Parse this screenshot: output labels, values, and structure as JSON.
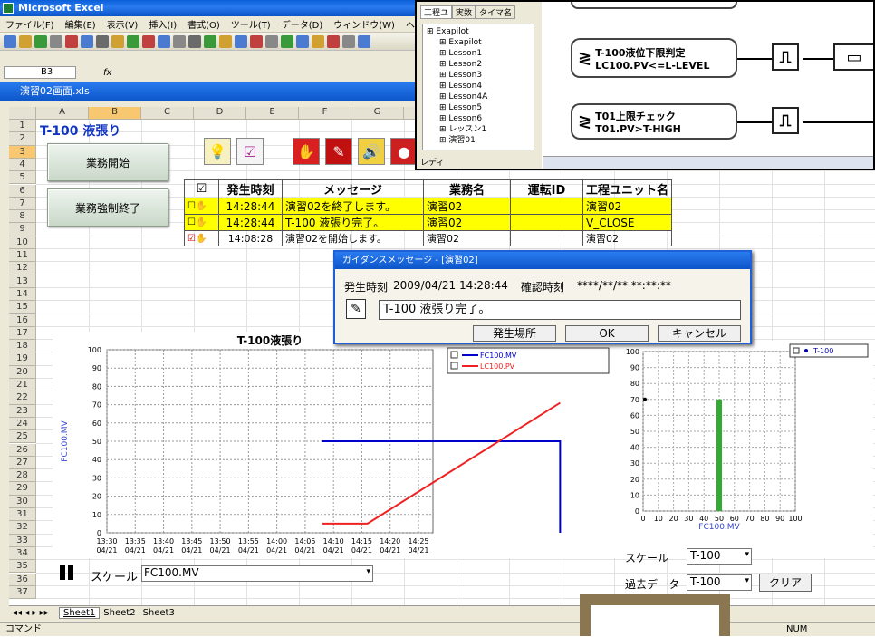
{
  "excel": {
    "title": "Microsoft Excel",
    "menu": [
      "ファイル(F)",
      "編集(E)",
      "表示(V)",
      "挿入(I)",
      "書式(O)",
      "ツール(T)",
      "データ(D)",
      "ウィンドウ(W)",
      "ヘルプ(H)"
    ],
    "namebox": "B3",
    "fx": "fx",
    "workbook_title": "演習02画面.xls",
    "columns": [
      "A",
      "B",
      "C",
      "D",
      "E",
      "F",
      "G"
    ],
    "rows": [
      "1",
      "2",
      "3",
      "4",
      "5",
      "6",
      "7",
      "8",
      "9",
      "10",
      "11",
      "12",
      "13",
      "14",
      "15",
      "16",
      "17",
      "18",
      "19",
      "20",
      "21",
      "22",
      "23",
      "24",
      "25",
      "26",
      "27",
      "28",
      "29",
      "30",
      "31",
      "32",
      "33",
      "34",
      "35",
      "36",
      "37"
    ],
    "cell_title": "T-100 液張り",
    "btn_start": "業務開始",
    "btn_force_end": "業務強制終了",
    "sheets": [
      "Sheet1",
      "Sheet2",
      "Sheet3"
    ],
    "status_left": "コマンド",
    "status_num": "NUM"
  },
  "events": {
    "headers": [
      "",
      "発生時刻",
      "メッセージ",
      "業務名",
      "運転ID",
      "工程ユニット名"
    ],
    "rows": [
      {
        "time": "14:28:44",
        "msg": "演習02を終了します。",
        "job": "演習02",
        "run_id": "",
        "unit": "演習02",
        "highlight": true
      },
      {
        "time": "14:28:44",
        "msg": "T-100 液張り完了。",
        "job": "演習02",
        "run_id": "",
        "unit": "V_CLOSE",
        "highlight": true
      },
      {
        "time": "14:08:28",
        "msg": "演習02を開始します。",
        "job": "演習02",
        "run_id": "",
        "unit": "演習02",
        "highlight": false
      }
    ]
  },
  "dialog": {
    "title": "ガイダンスメッセージ - [演習02]",
    "time_label": "発生時刻",
    "time_value": "2009/04/21 14:28:44",
    "confirm_label": "確認時刻",
    "confirm_value": "****/**/** **:**:**",
    "message": "T-100 液張り完了。",
    "btn_location": "発生場所",
    "btn_ok": "OK",
    "btn_cancel": "キャンセル"
  },
  "trend": {
    "title": "T-100液張り",
    "ylabel": "FC100.MV",
    "legend": [
      "FC100.MV",
      "LC100.PV"
    ],
    "scale_label": "スケール",
    "scale_value": "FC100.MV"
  },
  "bar_panel": {
    "legend": "T-100",
    "xlabel": "FC100.MV",
    "scale_label": "スケール",
    "scale_value": "T-100",
    "past_label": "過去データ",
    "past_value": "T-100",
    "clear": "クリア"
  },
  "chart_data": [
    {
      "type": "line",
      "title": "T-100液張り",
      "ylabel": "FC100.MV",
      "xlabel": "",
      "x": [
        "13:30\n04/21",
        "13:35\n04/21",
        "13:40\n04/21",
        "13:45\n04/21",
        "13:50\n04/21",
        "13:55\n04/21",
        "14:00\n04/21",
        "14:05\n04/21",
        "14:10\n04/21",
        "14:15\n04/21",
        "14:20\n04/21",
        "14:25\n04/21"
      ],
      "ylim": [
        0,
        100
      ],
      "series": [
        {
          "name": "FC100.MV",
          "color": "#0000cc",
          "points": [
            [
              14.08,
              50
            ],
            [
              14.5,
              50
            ],
            [
              14.5,
              0
            ]
          ]
        },
        {
          "name": "LC100.PV",
          "color": "#ee2222",
          "points": [
            [
              14.08,
              5
            ],
            [
              14.16,
              5
            ],
            [
              14.5,
              71
            ]
          ]
        }
      ]
    },
    {
      "type": "scatter",
      "title": "",
      "xlabel": "FC100.MV",
      "xlim": [
        0,
        100
      ],
      "ylim": [
        0,
        100
      ],
      "series": [
        {
          "name": "T-100",
          "color": "#0000aa",
          "points": [
            [
              50,
              70
            ]
          ]
        }
      ]
    }
  ],
  "flow": {
    "tabs": [
      "工程ユ",
      "実数",
      "タイマ名"
    ],
    "tree": [
      "Exapilot",
      "Exapilot",
      "Lesson1",
      "Lesson2",
      "Lesson3",
      "Lesson4",
      "Lesson4A",
      "Lesson5",
      "Lesson6",
      "レッスン1",
      "演習01"
    ],
    "node1": [
      "T-100液位下限判定",
      "LC100.PV<=L-LEVEL"
    ],
    "node2": [
      "T01上限チェック",
      "T01.PV>T-HIGH"
    ],
    "status": "レディ"
  },
  "colors": {
    "highlight": "#ffff00",
    "mv": "#0000cc",
    "pv": "#ee2222",
    "bar": "#33aa33"
  }
}
